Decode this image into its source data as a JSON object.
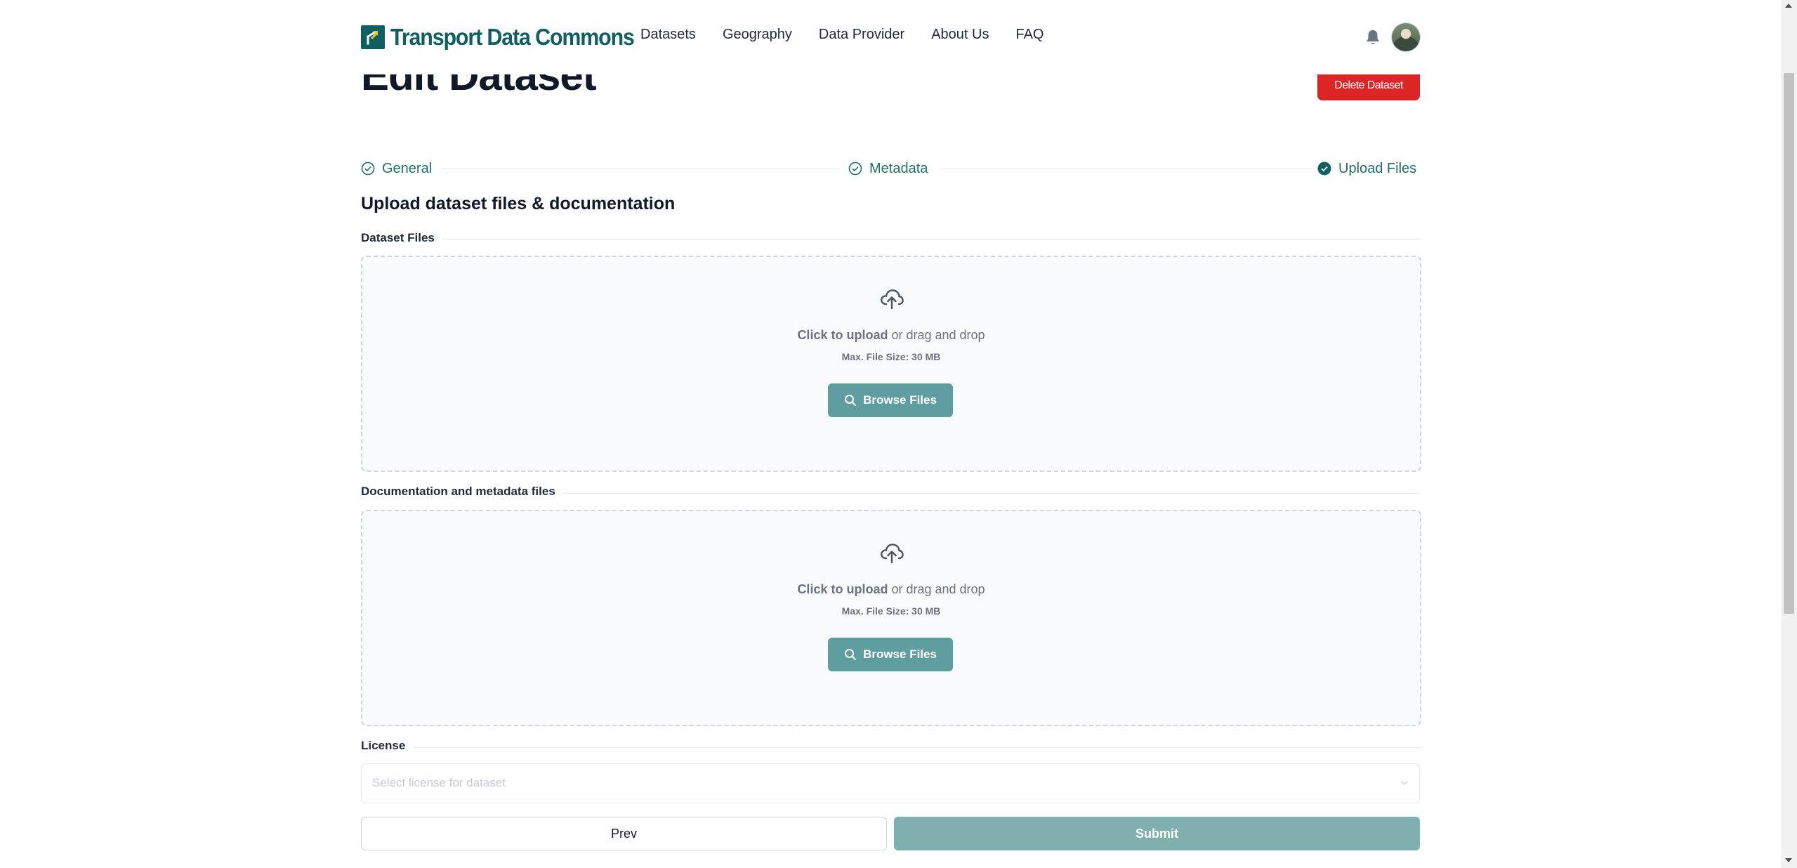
{
  "header": {
    "brand": "Transport Data Commons",
    "nav": [
      {
        "label": "Datasets"
      },
      {
        "label": "Geography"
      },
      {
        "label": "Data Provider"
      },
      {
        "label": "About Us"
      },
      {
        "label": "FAQ"
      }
    ],
    "icons": {
      "notifications": "bell-icon",
      "user": "avatar"
    }
  },
  "page": {
    "title": "Edit Dataset",
    "delete_label": "Delete Dataset"
  },
  "stepper": {
    "steps": [
      {
        "label": "General",
        "state": "completed"
      },
      {
        "label": "Metadata",
        "state": "completed"
      },
      {
        "label": "Upload Files",
        "state": "current"
      }
    ]
  },
  "upload": {
    "heading": "Upload dataset files & documentation",
    "dataset_files": {
      "label": "Dataset Files",
      "click_text": "Click to upload",
      "drag_text": " or drag and drop",
      "max_size": "Max. File Size: 30 MB",
      "browse_label": "Browse Files"
    },
    "documentation_files": {
      "label": "Documentation and metadata files",
      "click_text": "Click to upload",
      "drag_text": " or drag and drop",
      "max_size": "Max. File Size: 30 MB",
      "browse_label": "Browse Files"
    },
    "license": {
      "label": "License",
      "placeholder": "Select license for dataset"
    }
  },
  "actions": {
    "prev_label": "Prev",
    "submit_label": "Submit"
  },
  "colors": {
    "brand": "#0f5f63",
    "accent": "#5f9ea0",
    "danger": "#dc2626",
    "submit_disabled": "#7fb0ae"
  }
}
